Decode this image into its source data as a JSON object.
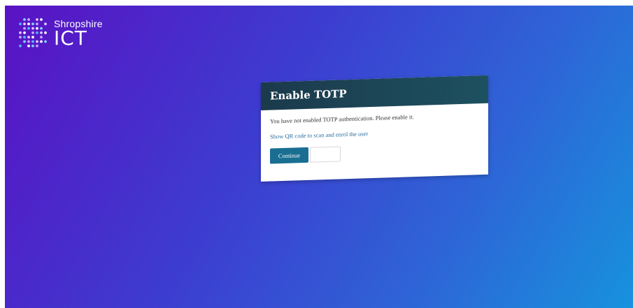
{
  "logo": {
    "small_text": "Shropshire",
    "big_text": "ICT",
    "icon": "dot-grid-logo-icon"
  },
  "dialog": {
    "title": "Enable TOTP",
    "message": "You have not enabled TOTP authentication. Please enable it.",
    "qr_link": "Show QR code to scan and enrol the user",
    "continue_label": "Continue",
    "secondary_label": ""
  },
  "colors": {
    "background_start": "#5a12c4",
    "background_end": "#1792dd",
    "header": "#1b3a4c",
    "button": "#1a6e92",
    "link": "#2a6ea0"
  }
}
